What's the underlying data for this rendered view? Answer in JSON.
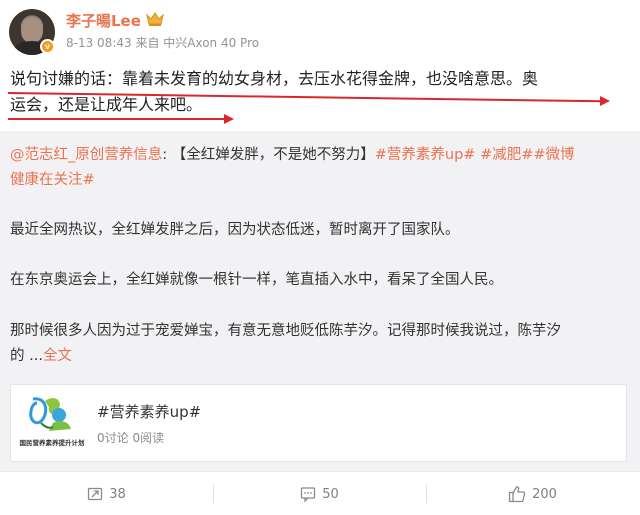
{
  "author": {
    "name": "李子暘Lee",
    "verified_badge": "v",
    "meta": "8-13 08:43 来自 中兴Axon 40 Pro"
  },
  "post": {
    "line1": "说句讨嫌的话：靠着未发育的幼女身材，去压水花得金牌，也没啥意思。奥",
    "line2": "运会，还是让成年人来吧。",
    "annotation_color": "#d9272e"
  },
  "repost": {
    "mention": "@范志红_原创营养信息",
    "colon": ":",
    "title_text": "【全红婵发胖，不是她不努力】",
    "tag1": "#营养素养up#",
    "tag2": "#减肥#",
    "tag3": "#微博",
    "tag3_cont": "健康在关注#",
    "para1": "最近全网热议，全红婵发胖之后，因为状态低迷，暂时离开了国家队。",
    "para2": "在东京奥运会上，全红婵就像一根针一样，笔直插入水中，看呆了全国人民。",
    "para3_line1": "那时候很多人因为过于宠爱婵宝，有意无意地贬低陈芋汐。记得那时候我说过，陈芋汐",
    "para3_line2": "的 ...",
    "more_link": "全文"
  },
  "topic_card": {
    "logo_caption": "国民营养素养提升计划",
    "title": "#营养素养up#",
    "stats": "0讨论 0阅读"
  },
  "actions": {
    "repost_count": "38",
    "comment_count": "50",
    "like_count": "200"
  },
  "colors": {
    "accent": "#eb7350",
    "link": "#eb7350",
    "repost_bg": "#f2f2f5"
  }
}
